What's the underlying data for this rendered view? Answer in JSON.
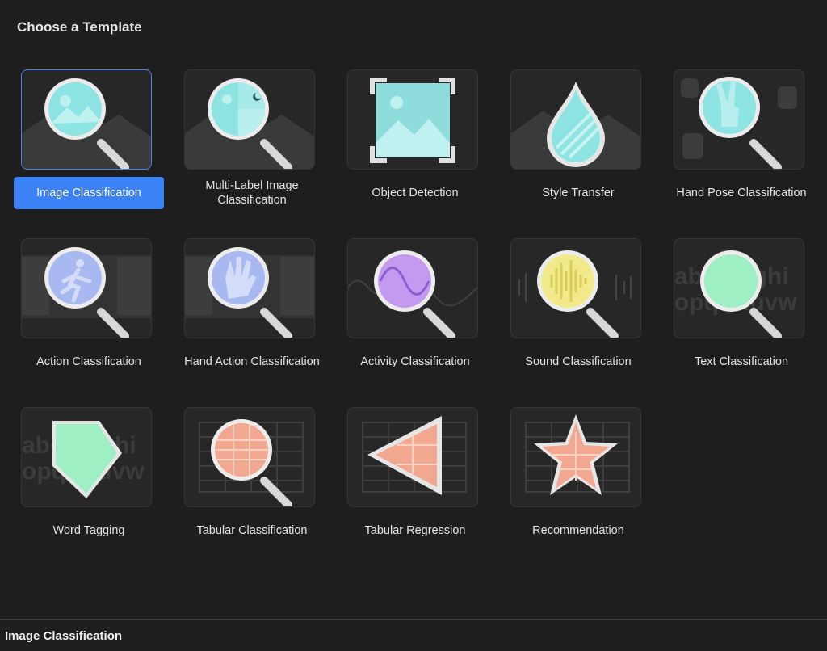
{
  "header": {
    "title": "Choose a Template"
  },
  "templates": [
    {
      "label": "Image Classification",
      "icon": "image-magnifier-icon",
      "selected": true
    },
    {
      "label": "Multi-Label Image Classification",
      "icon": "multi-label-magnifier-icon"
    },
    {
      "label": "Object Detection",
      "icon": "object-detection-icon"
    },
    {
      "label": "Style Transfer",
      "icon": "style-drop-icon"
    },
    {
      "label": "Hand Pose Classification",
      "icon": "hand-pose-magnifier-icon"
    },
    {
      "label": "Action Classification",
      "icon": "action-magnifier-icon"
    },
    {
      "label": "Hand Action Classification",
      "icon": "hand-action-magnifier-icon"
    },
    {
      "label": "Activity Classification",
      "icon": "activity-magnifier-icon"
    },
    {
      "label": "Sound Classification",
      "icon": "sound-magnifier-icon"
    },
    {
      "label": "Text Classification",
      "icon": "text-magnifier-icon"
    },
    {
      "label": "Word Tagging",
      "icon": "word-tag-icon"
    },
    {
      "label": "Tabular Classification",
      "icon": "tabular-magnifier-icon"
    },
    {
      "label": "Tabular Regression",
      "icon": "tabular-triangle-icon"
    },
    {
      "label": "Recommendation",
      "icon": "star-icon"
    }
  ],
  "footer": {
    "selected_title": "Image Classification"
  },
  "colors": {
    "accent": "#3b82f6",
    "background": "#1e1e1e",
    "tile": "#272727"
  }
}
